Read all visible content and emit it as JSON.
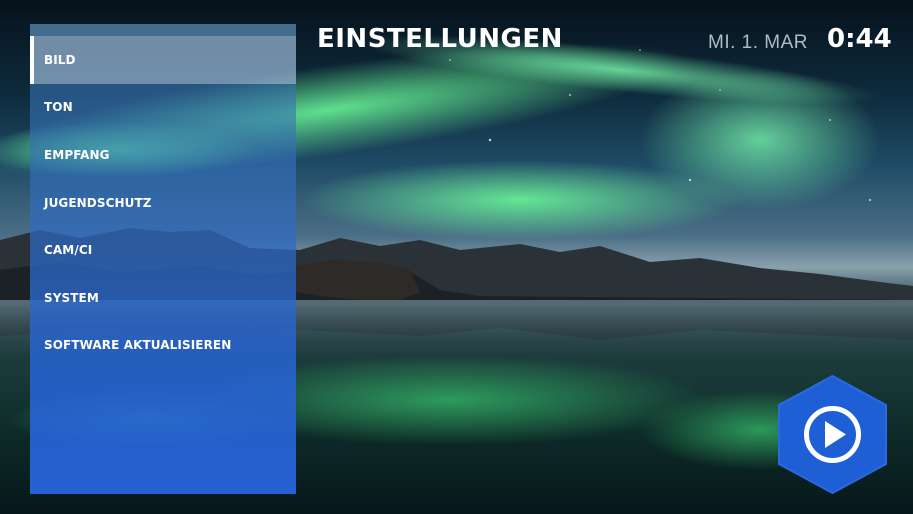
{
  "header": {
    "title": "EINSTELLUNGEN",
    "date": "MI. 1. MAR",
    "time": "0:44"
  },
  "sidebar": {
    "active_index": 0,
    "items": [
      {
        "label": "BILD"
      },
      {
        "label": "TON"
      },
      {
        "label": "EMPFANG"
      },
      {
        "label": "JUGENDSCHUTZ"
      },
      {
        "label": "CAM/CI"
      },
      {
        "label": "SYSTEM"
      },
      {
        "label": "SOFTWARE AKTUALISIEREN"
      }
    ]
  },
  "play_button": {
    "icon": "play-icon"
  },
  "colors": {
    "sidebar_blue": "#2a64dc",
    "play_hex_blue": "#1f5fd6",
    "text": "#ffffff"
  }
}
